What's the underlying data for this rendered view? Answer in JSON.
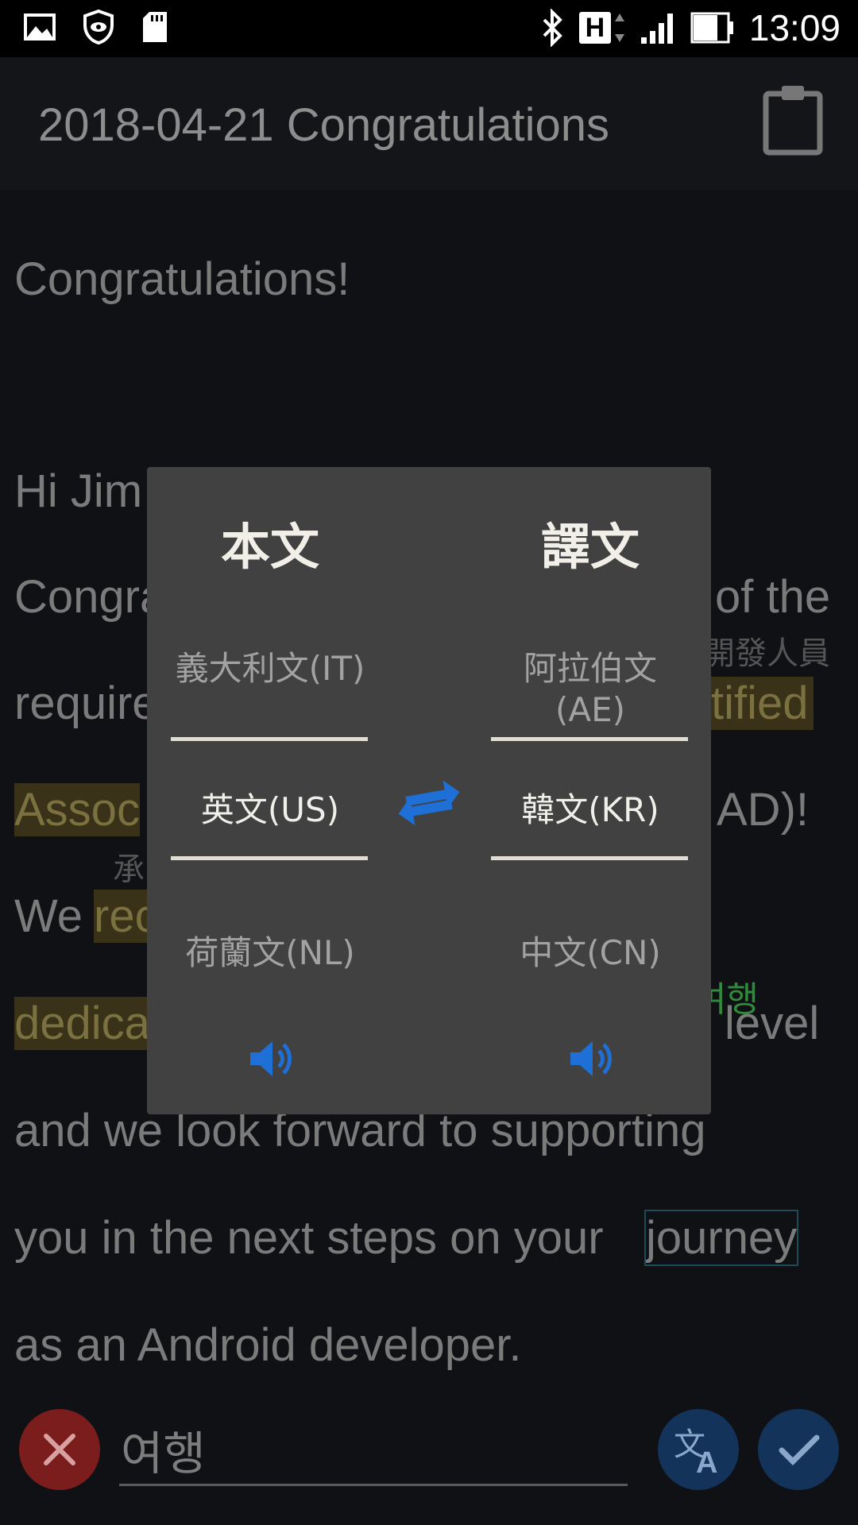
{
  "status_bar": {
    "time": "13:09",
    "network_label": "H"
  },
  "app_bar": {
    "title": "2018-04-21 Congratulations"
  },
  "document": {
    "lines": [
      "Congratulations!",
      "Hi Jim",
      "Congra",
      "of the",
      "require",
      "tified",
      "Assoc",
      "AD)!",
      "We",
      "rec",
      "dedica",
      "level",
      "and we look forward to supporting",
      "you in the next steps on your",
      "journey",
      "as an Android developer."
    ],
    "annotation_cjk": "開發人員",
    "annotation_cjk_short": "承",
    "annotation_korean": "여행"
  },
  "dialog": {
    "source": {
      "title": "本文",
      "prev": "義大利文(IT)",
      "current": "英文(US)",
      "next": "荷蘭文(NL)"
    },
    "target": {
      "title": "譯文",
      "prev": "阿拉伯文(AE)",
      "current": "韓文(KR)",
      "next": "中文(CN)"
    },
    "accent_color": "#1e6fd6"
  },
  "bottom_bar": {
    "input_value": "여행"
  },
  "icons": [
    "image-icon",
    "shield-eye-icon",
    "sd-card-icon",
    "bluetooth-icon",
    "signal-icon",
    "battery-icon",
    "clipboard-icon",
    "swap-icon",
    "speaker-icon",
    "close-icon",
    "translate-icon",
    "check-icon"
  ]
}
